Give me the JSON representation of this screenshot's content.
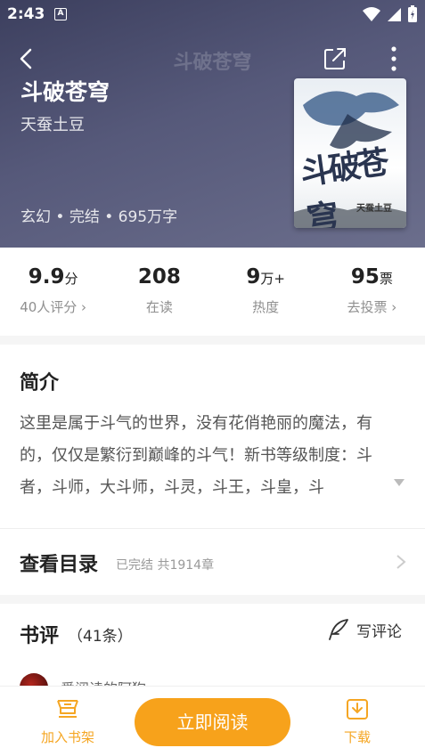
{
  "status_bar": {
    "time": "2:43",
    "notif_letter": "A"
  },
  "nav": {
    "title": "斗破苍穹"
  },
  "book": {
    "title": "斗破苍穹",
    "author": "天蚕土豆",
    "meta": "玄幻 • 完结 • 695万字",
    "cover_title": "斗破苍穹",
    "cover_author": "天蚕土豆"
  },
  "stats": [
    {
      "value": "9.9",
      "unit": "分",
      "label": "40人评分 ›"
    },
    {
      "value": "208",
      "unit": "",
      "label": "在读"
    },
    {
      "value": "9",
      "unit": "万+",
      "label": "热度"
    },
    {
      "value": "95",
      "unit": "票",
      "label": "去投票 ›"
    }
  ],
  "intro": {
    "title": "简介",
    "text": "这里是属于斗气的世界，没有花俏艳丽的魔法，有的，仅仅是繁衍到巅峰的斗气！新书等级制度：斗者，斗师，大斗师，斗灵，斗王，斗皇，斗"
  },
  "catalog": {
    "title": "查看目录",
    "subtitle": "已完结 共1914章"
  },
  "reviews": {
    "title": "书评",
    "count": "（41条）",
    "write_label": "写评论",
    "first_reviewer": "爱阅读的阿狗"
  },
  "bottom": {
    "shelf_label": "加入书架",
    "read_label": "立即阅读",
    "download_label": "下载"
  },
  "colors": {
    "accent": "#f7a21b",
    "header_bg": "#4b4e6e"
  }
}
